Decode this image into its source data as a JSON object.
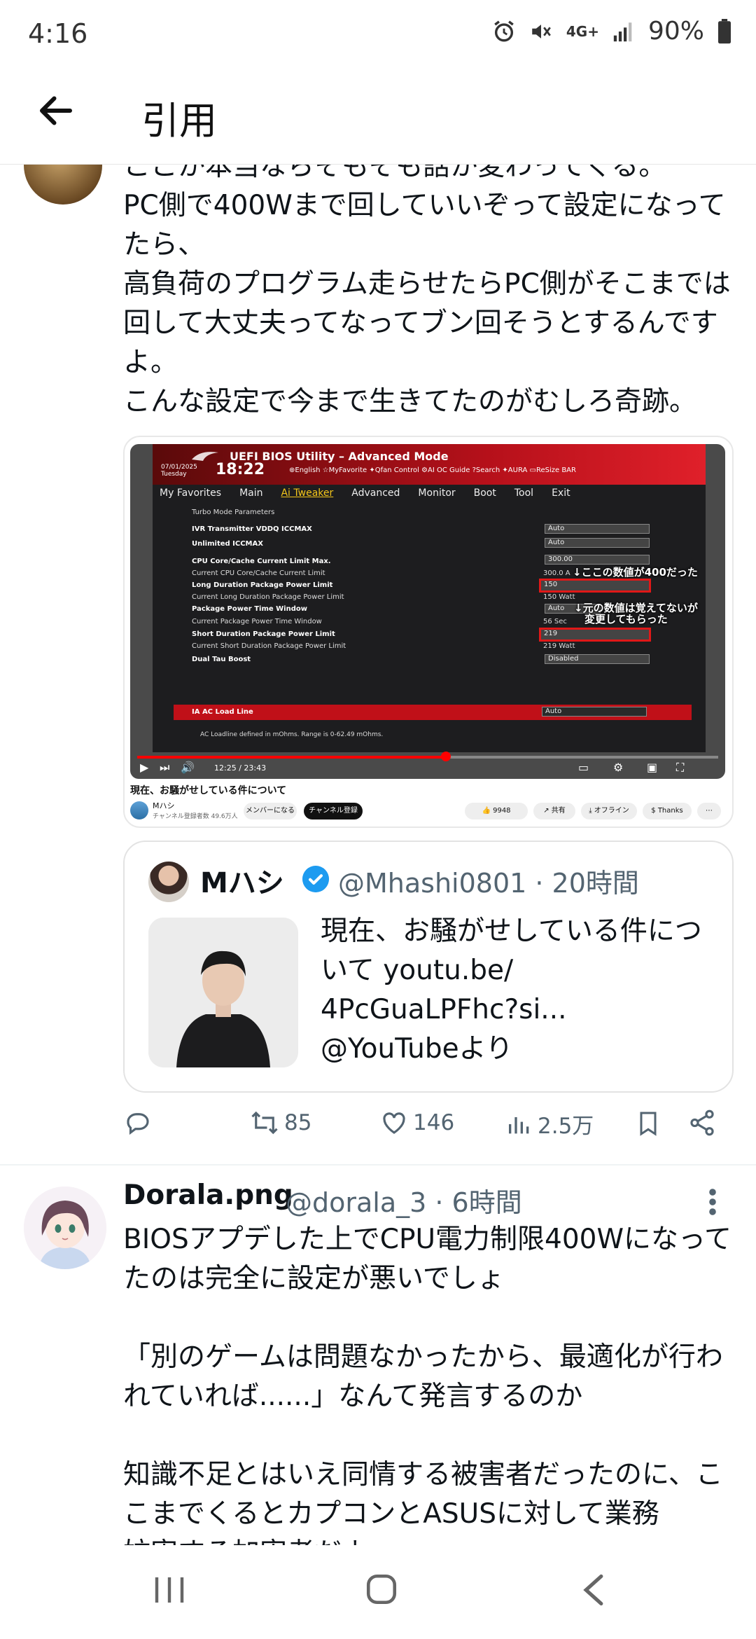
{
  "status_bar": {
    "time": "4:16",
    "network": "4G+",
    "battery": "90%"
  },
  "header": {
    "title": "引用"
  },
  "tweet1": {
    "cut_line": "ここか本当ならそもそも話か変わってくる。",
    "lines": "PC側で400Wまで回していいぞって設定になってたら、\n高負荷のプログラム走らせたらPC側がそこまでは回して大丈夫ってなってブン回そうとするんですよ。\nこんな設定で今まで生きてたのがむしろ奇跡。"
  },
  "video": {
    "bios_title": "UEFI BIOS Utility – Advanced Mode",
    "bios_date": "07/01/2025\nTuesday",
    "bios_clock": "18:22",
    "bios_toolbar": "⊕English  ☆MyFavorite  ✦Qfan Control  ⚙AI OC Guide  ?Search  ✦AURA  ▭ReSize BAR",
    "menu": [
      "My Favorites",
      "Main",
      "Ai Tweaker",
      "Advanced",
      "Monitor",
      "Boot",
      "Tool",
      "Exit"
    ],
    "section": "Turbo Mode Parameters",
    "rows": [
      "IVR Transmitter VDDQ ICCMAX",
      "Unlimited ICCMAX",
      "CPU Core/Cache Current Limit Max.",
      "Current CPU Core/Cache Current Limit",
      "Long Duration Package Power Limit",
      "Current Long Duration Package Power Limit",
      "Package Power Time Window",
      "Current Package Power Time Window",
      "Short Duration Package Power Limit",
      "Current Short Duration Package Power Limit",
      "Dual Tau Boost",
      "IA AC Load Line"
    ],
    "values": [
      "Auto",
      "Auto",
      "300.00",
      "300.0 A",
      "150",
      "150 Watt",
      "Auto",
      "56 Sec",
      "219",
      "219 Watt",
      "Disabled",
      "Auto"
    ],
    "annotation1": "↓ここの数値が400だった",
    "annotation2": "↓元の数値は覚えてないが\n　変更してもらった",
    "footnote": "AC Loadline defined in mOhms. Range is 0-62.49 mOhms.",
    "time": "12:25 / 23:43",
    "yt_title": "現在、お騒がせしている件について",
    "channel": "Mハシ",
    "subs": "チャンネル登録者数 49.6万人",
    "member_btn": "メンバーになる",
    "subscribe_btn": "チャンネル登録",
    "likes": "9948",
    "share": "共有",
    "offline": "オフライン",
    "thanks": "Thanks"
  },
  "quote": {
    "name": "Mハシ",
    "handle": "@Mhashi0801 · 20時間",
    "text": "現在、お騒がせしている件について youtu.be/\n4PcGuaLPFhc?si...\n@YouTubeより"
  },
  "actions": {
    "retweets": "85",
    "likes": "146",
    "views": "2.5万"
  },
  "tweet2": {
    "name": "Dorala.png",
    "handle": "@dorala_3 · 6時間",
    "text": "BIOSアプデした上でCPU電力制限400Wになってたのは完全に設定が悪いでしょ\n\n「別のゲームは問題なかったから、最適化が行われていれば......」なんて発言するのか\n\n知識不足とはいえ同情する被害者だったのに、ここまでくるとカプコンとASUSに対して業務\n妨害する加害者だよ"
  },
  "colors": {
    "accent": "#1d9bf0",
    "secondary_text": "#536471",
    "bios_red": "#c01018"
  }
}
